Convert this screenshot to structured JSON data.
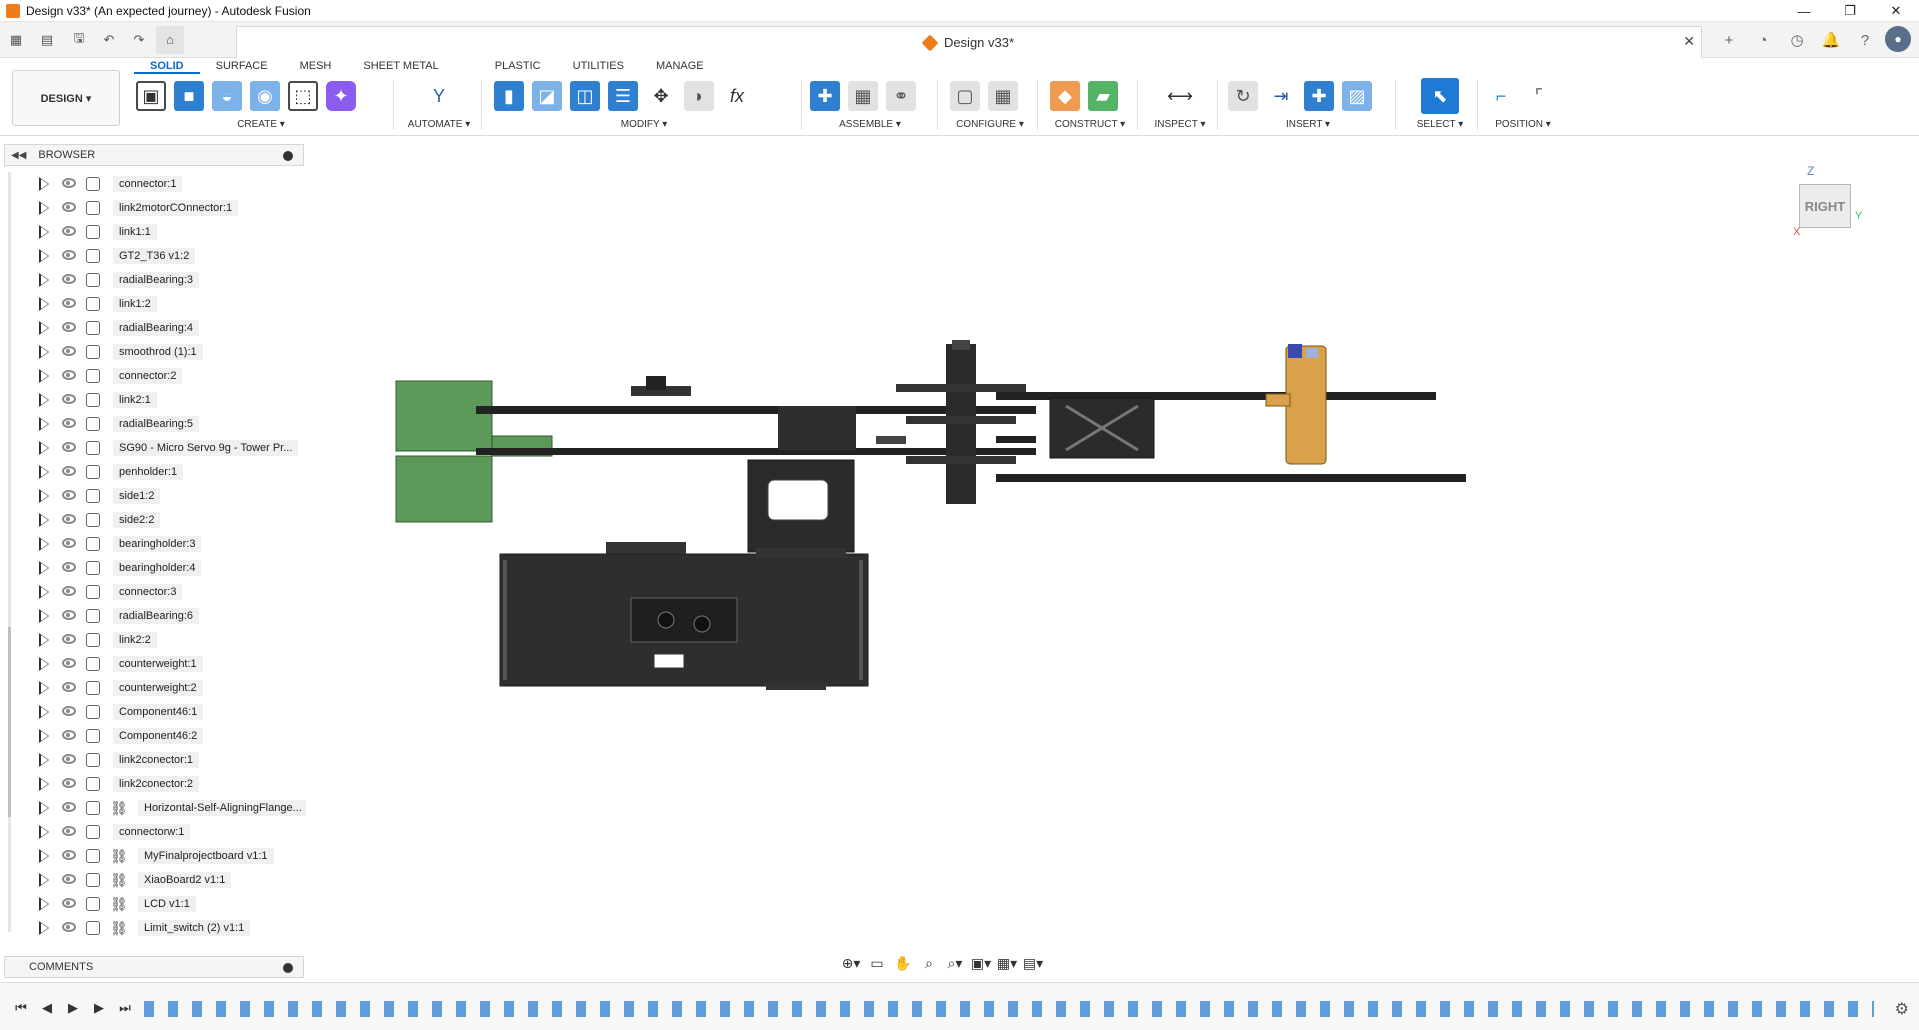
{
  "window": {
    "title": "Design v33* (An expected journey) - Autodesk Fusion",
    "controls": [
      "—",
      "❐",
      "✕"
    ]
  },
  "document": {
    "tab_title": "Design v33*",
    "close_glyph": "✕"
  },
  "appbar": {
    "grid_glyph": "▦",
    "file_glyph": "▤",
    "save_glyph": "🖫",
    "undo_glyph": "↶",
    "redo_glyph": "↷",
    "home_glyph": "⌂",
    "plus_glyph": "+",
    "right_glyphs": [
      "◔",
      "◷",
      "🔔",
      "?"
    ],
    "avatar_glyph": "●"
  },
  "ribbon": {
    "workspace_label": "DESIGN ▾",
    "tabs": [
      "SOLID",
      "SURFACE",
      "MESH",
      "SHEET METAL",
      "PLASTIC",
      "UTILITIES",
      "MANAGE"
    ],
    "active_tab": "SOLID",
    "groups": [
      {
        "label": "CREATE ▾"
      },
      {
        "label": "AUTOMATE ▾"
      },
      {
        "label": "MODIFY ▾"
      },
      {
        "label": "ASSEMBLE ▾"
      },
      {
        "label": "CONFIGURE ▾"
      },
      {
        "label": "CONSTRUCT ▾"
      },
      {
        "label": "INSPECT ▾"
      },
      {
        "label": "INSERT ▾"
      },
      {
        "label": "SELECT ▾"
      },
      {
        "label": "POSITION ▾"
      }
    ],
    "icon_glyphs": {
      "create": [
        "▣",
        "■",
        "◒",
        "◉",
        "⬚",
        "✦"
      ],
      "automate": [
        "Y"
      ],
      "modify": [
        "▮",
        "◪",
        "◫",
        "☰",
        "✥",
        "◗",
        "fx"
      ],
      "assemble": [
        "✚",
        "▦",
        "⚭"
      ],
      "configure": [
        "▢",
        "▦"
      ],
      "construct": [
        "◆",
        "▰"
      ],
      "inspect": [
        "⟷"
      ],
      "insert": [
        "↻",
        "⇥",
        "✚",
        "▨"
      ],
      "select": [
        "⬉"
      ],
      "position": [
        "⌐",
        "⌜"
      ]
    }
  },
  "browser": {
    "title": "BROWSER",
    "items": [
      {
        "label": "connector:1",
        "linked": false
      },
      {
        "label": "link2motorCOnnector:1",
        "linked": false
      },
      {
        "label": "link1:1",
        "linked": false
      },
      {
        "label": "GT2_T36 v1:2",
        "linked": false
      },
      {
        "label": "radialBearing:3",
        "linked": false
      },
      {
        "label": "link1:2",
        "linked": false
      },
      {
        "label": "radialBearing:4",
        "linked": false
      },
      {
        "label": "smoothrod (1):1",
        "linked": false
      },
      {
        "label": "connector:2",
        "linked": false
      },
      {
        "label": "link2:1",
        "linked": false
      },
      {
        "label": "radialBearing:5",
        "linked": false
      },
      {
        "label": "SG90 - Micro Servo 9g - Tower Pr...",
        "linked": false
      },
      {
        "label": "penholder:1",
        "linked": false
      },
      {
        "label": "side1:2",
        "linked": false
      },
      {
        "label": "side2:2",
        "linked": false
      },
      {
        "label": "bearingholder:3",
        "linked": false
      },
      {
        "label": "bearingholder:4",
        "linked": false
      },
      {
        "label": "connector:3",
        "linked": false
      },
      {
        "label": "radialBearing:6",
        "linked": false
      },
      {
        "label": "link2:2",
        "linked": false
      },
      {
        "label": "counterweight:1",
        "linked": false
      },
      {
        "label": "counterweight:2",
        "linked": false
      },
      {
        "label": "Component46:1",
        "linked": false
      },
      {
        "label": "Component46:2",
        "linked": false
      },
      {
        "label": "link2conector:1",
        "linked": false
      },
      {
        "label": "link2conector:2",
        "linked": false
      },
      {
        "label": "Horizontal-Self-AligningFlange...",
        "linked": true
      },
      {
        "label": "connectorw:1",
        "linked": false
      },
      {
        "label": "MyFinalprojectboard v1:1",
        "linked": true
      },
      {
        "label": "XiaoBoard2 v1:1",
        "linked": true
      },
      {
        "label": "LCD v1:1",
        "linked": true
      },
      {
        "label": "Limit_switch (2) v1:1",
        "linked": true
      }
    ]
  },
  "comments": {
    "title": "COMMENTS"
  },
  "viewcube": {
    "face": "RIGHT",
    "z": "Z",
    "y": "Y",
    "x": "X"
  },
  "navbar": {
    "glyphs": [
      "⊕▾",
      "▭",
      "✋",
      "⌕",
      "⌕▾",
      "▣▾",
      "▦▾",
      "▤▾"
    ]
  },
  "timeline": {
    "controls": [
      "⏮",
      "◀",
      "▶",
      "▶",
      "⏭"
    ],
    "settings_glyph": "⚙"
  },
  "colors": {
    "accent": "#0a6cc7",
    "fusion_orange": "#f07b1d",
    "model_dark": "#2e2e2e",
    "model_green": "#5d9a5a",
    "model_gold": "#d9a24a"
  }
}
